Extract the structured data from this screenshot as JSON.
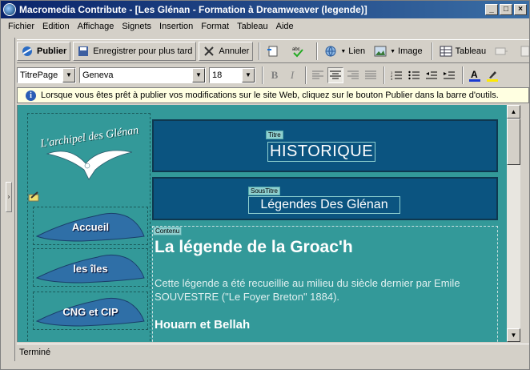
{
  "window": {
    "title": "Macromedia Contribute - [Les Glénan - Formation à Dreamweaver (legende)]"
  },
  "menu": [
    "Fichier",
    "Edition",
    "Affichage",
    "Signets",
    "Insertion",
    "Format",
    "Tableau",
    "Aide"
  ],
  "toolbar": {
    "publish": "Publier",
    "save_later": "Enregistrer pour plus tard",
    "cancel": "Annuler",
    "link": "Lien",
    "image": "Image",
    "table": "Tableau"
  },
  "format_bar": {
    "style": "TitrePage",
    "font": "Geneva",
    "size": "18"
  },
  "info": {
    "message": "Lorsque vous êtes prêt à publier vos modifications sur le site Web, cliquez sur le bouton Publier dans la barre d'outils."
  },
  "page": {
    "logo_text": "L'archipel des Glénan",
    "nav": [
      "Accueil",
      "les îles",
      "CNG et CIP"
    ],
    "titre_tag": "Titre",
    "titre": "HISTORIQUE",
    "soustitre_tag": "SousTitre",
    "soustitre": "Légendes Des Glénan",
    "contenu_tag": "Contenu",
    "heading": "La légende de la Groac'h",
    "paragraph": "Cette légende a été recueillie au milieu du siècle dernier par Emile SOUVESTRE (\"Le Foyer Breton\" 1884).",
    "subheading": "Houarn et Bellah"
  },
  "status": {
    "text": "Terminé"
  },
  "colors": {
    "canvas": "#339999",
    "title_box": "#0b5480",
    "info_bg": "#ffffe1"
  }
}
